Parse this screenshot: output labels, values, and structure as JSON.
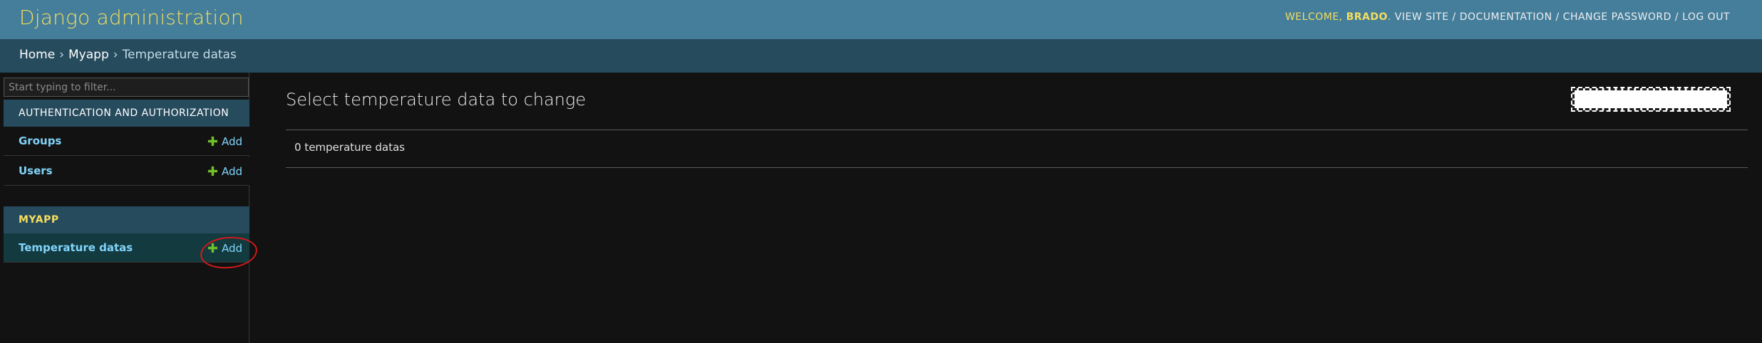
{
  "header": {
    "site_name": "Django administration",
    "welcome": "WELCOME,",
    "username": "BRADO",
    "links": {
      "view_site": "VIEW SITE",
      "documentation": "DOCUMENTATION",
      "change_password": "CHANGE PASSWORD",
      "log_out": "LOG OUT"
    },
    "separator": "/"
  },
  "breadcrumbs": {
    "home": "Home",
    "app": "Myapp",
    "current": "Temperature datas",
    "separator": "›"
  },
  "sidebar": {
    "filter_placeholder": "Start typing to filter...",
    "modules": [
      {
        "caption": "Authentication and Authorization",
        "models": [
          {
            "name": "Groups",
            "add_label": "Add"
          },
          {
            "name": "Users",
            "add_label": "Add"
          }
        ]
      },
      {
        "caption": "Myapp",
        "models": [
          {
            "name": "Temperature datas",
            "add_label": "Add",
            "current": true
          }
        ]
      }
    ]
  },
  "content": {
    "title": "Select temperature data to change",
    "result_count": "0 temperature datas"
  },
  "colors": {
    "header_bg": "#447e9b",
    "breadcrumbs_bg": "#264b5d",
    "accent_yellow": "#f5dd5d",
    "link_blue": "#81d4fa",
    "add_green": "#70bf2b",
    "annotation_red": "#d11a1a"
  },
  "icons": {
    "add": "plus-icon"
  }
}
